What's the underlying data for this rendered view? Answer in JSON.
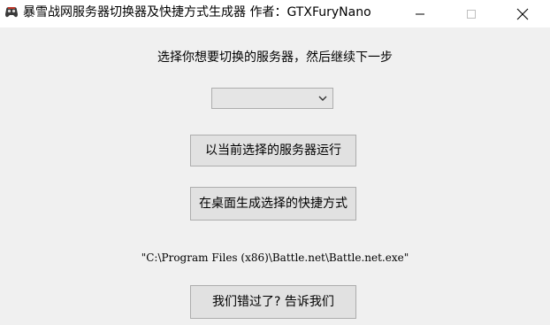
{
  "window": {
    "title": "暴雪战网服务器切换器及快捷方式生成器 作者：GTXFuryNano",
    "icon": "gamepad-icon",
    "controls": {
      "minimize": "minimize-icon",
      "maximize": "maximize-icon",
      "close": "close-icon"
    }
  },
  "main": {
    "prompt": "选择你想要切换的服务器，然后继续下一步",
    "server_select": {
      "value": ""
    },
    "run_button": "以当前选择的服务器运行",
    "shortcut_button": "在桌面生成选择的快捷方式",
    "path": "\"C:\\Program Files (x86)\\Battle.net\\Battle.net.exe\"",
    "report_button": "我们错过了? 告诉我们"
  },
  "colors": {
    "background": "#f0f0f0",
    "button_face": "#e1e1e1",
    "button_border": "#adadad",
    "titlebar": "#ffffff"
  }
}
